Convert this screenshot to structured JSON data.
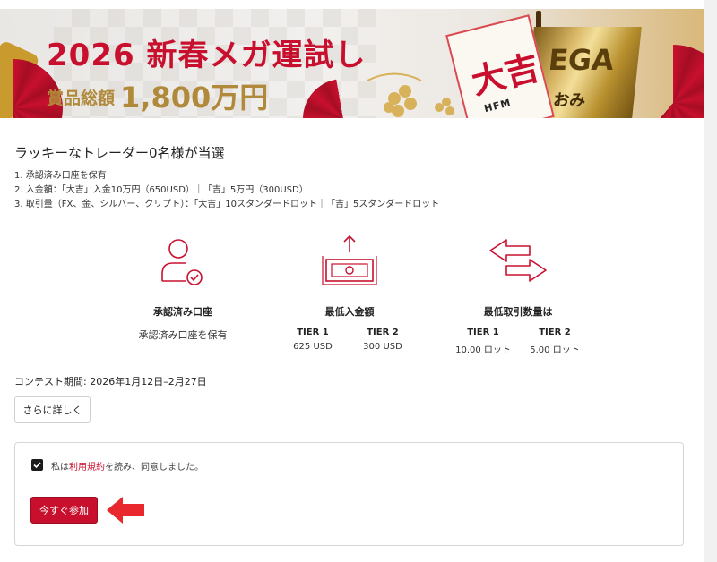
{
  "banner": {
    "title": "2026 新春メガ運試し",
    "prize_label": "賞品総額",
    "prize_amount": "1,800万円",
    "omikuji_char": "大吉",
    "omikuji_brand": "HFM",
    "box_text": "EGA",
    "box_sub": "おみ"
  },
  "headline": "ラッキーなトレーダー0名様が当選",
  "rules": [
    "1. 承認済み口座を保有",
    "2. 入金額：「大吉」入金10万円（650USD）｜「吉」5万円（300USD）",
    "3. 取引量（FX、金、シルバー、クリプト）：「大吉」10スタンダードロット｜「吉」5スタンダードロット"
  ],
  "features": {
    "account": {
      "title": "承認済み口座",
      "text": "承認済み口座を保有"
    },
    "deposit": {
      "title": "最低入金額",
      "tier1_label": "TIER 1",
      "tier1_value": "625 USD",
      "tier2_label": "TIER 2",
      "tier2_value": "300 USD"
    },
    "volume": {
      "title": "最低取引数量は",
      "tier1_label": "TIER 1",
      "tier1_value": "10.00 ロット",
      "tier2_label": "TIER 2",
      "tier2_value": "5.00 ロット"
    }
  },
  "period": "コンテスト期間: 2026年1月12日–2月27日",
  "more_button": "さらに詳しく",
  "agree": {
    "prefix": "私は",
    "link": "利用規約",
    "suffix": "を読み、同意しました。",
    "checked": true
  },
  "join_button": "今すぐ参加",
  "colors": {
    "accent": "#c8102e",
    "gold": "#b08a3a"
  }
}
